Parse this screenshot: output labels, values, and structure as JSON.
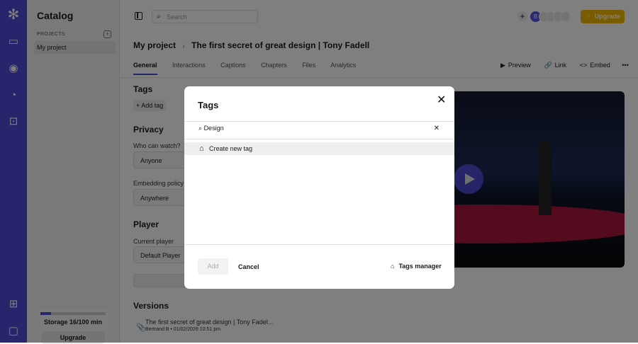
{
  "catalog": {
    "title": "Catalog",
    "projects_label": "PROJECTS",
    "project": "My project",
    "storage": "Storage 16/100 min",
    "storage_fraction": 0.16,
    "upgrade": "Upgrade"
  },
  "top": {
    "search_placeholder": "Search",
    "avatar_initial": "B",
    "upgrade": "Upgrade"
  },
  "breadcrumb": {
    "project": "My project",
    "sep": "›",
    "video": "The first secret of great design | Tony Fadell"
  },
  "tabs": [
    "General",
    "Interactions",
    "Captions",
    "Chapters",
    "Files",
    "Analytics"
  ],
  "actions": {
    "preview": "Preview",
    "link": "Link",
    "embed": "Embed",
    "more": "•••"
  },
  "left": {
    "tags": "Tags",
    "add_tag": "Add tag",
    "privacy": "Privacy",
    "who": "Who can watch?",
    "who_val": "Anyone",
    "embedding": "Embedding policy",
    "embedding_val": "Anywhere",
    "player": "Player",
    "current_player": "Current player",
    "player_val": "Default Player",
    "versions": "Versions",
    "version_title": "The first secret of great design | Tony Fadel...",
    "version_meta": "Bertrand B • 01/02/2026 10:51 pm"
  },
  "modal": {
    "title": "Tags",
    "search_value": "Design",
    "create": "Create new tag",
    "add": "Add",
    "cancel": "Cancel",
    "tags_manager": "Tags manager"
  }
}
